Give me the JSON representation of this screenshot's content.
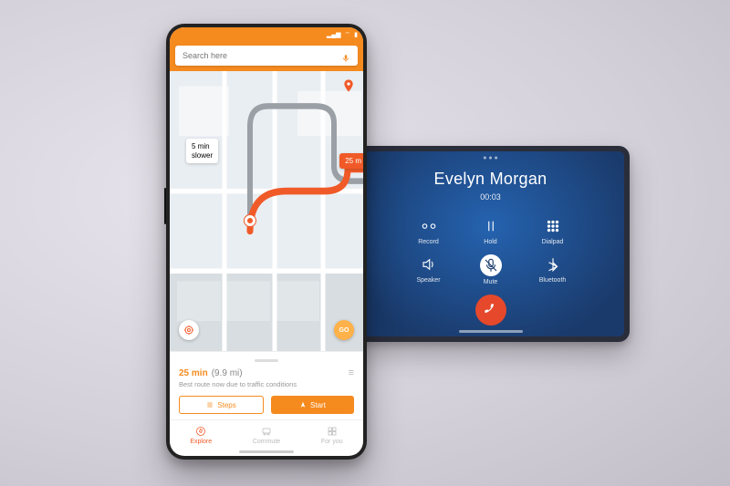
{
  "status_bar": {
    "carrier": "",
    "wifi": true,
    "signal": true,
    "battery": 100
  },
  "search": {
    "placeholder": "Search here"
  },
  "map": {
    "slower_callout": "5 min\nslower",
    "eta_callout": "25 m"
  },
  "route_panel": {
    "eta": "25 min",
    "distance": "(9.9 mi)",
    "subtitle": "Best route now due to traffic conditions",
    "steps_label": "Steps",
    "start_label": "Start"
  },
  "go_button": "GO",
  "tabs": [
    {
      "label": "Explore",
      "active": true
    },
    {
      "label": "Commute",
      "active": false
    },
    {
      "label": "For you",
      "active": false
    }
  ],
  "call": {
    "name": "Evelyn Morgan",
    "duration": "00:03",
    "buttons": [
      {
        "label": "Record"
      },
      {
        "label": "Hold"
      },
      {
        "label": "Dialpad"
      },
      {
        "label": "Speaker"
      },
      {
        "label": "Mute"
      },
      {
        "label": "Bluetooth"
      }
    ]
  },
  "colors": {
    "accent": "#f58a1f",
    "route": "#f05a28",
    "call_bg": "#1d3e73"
  }
}
